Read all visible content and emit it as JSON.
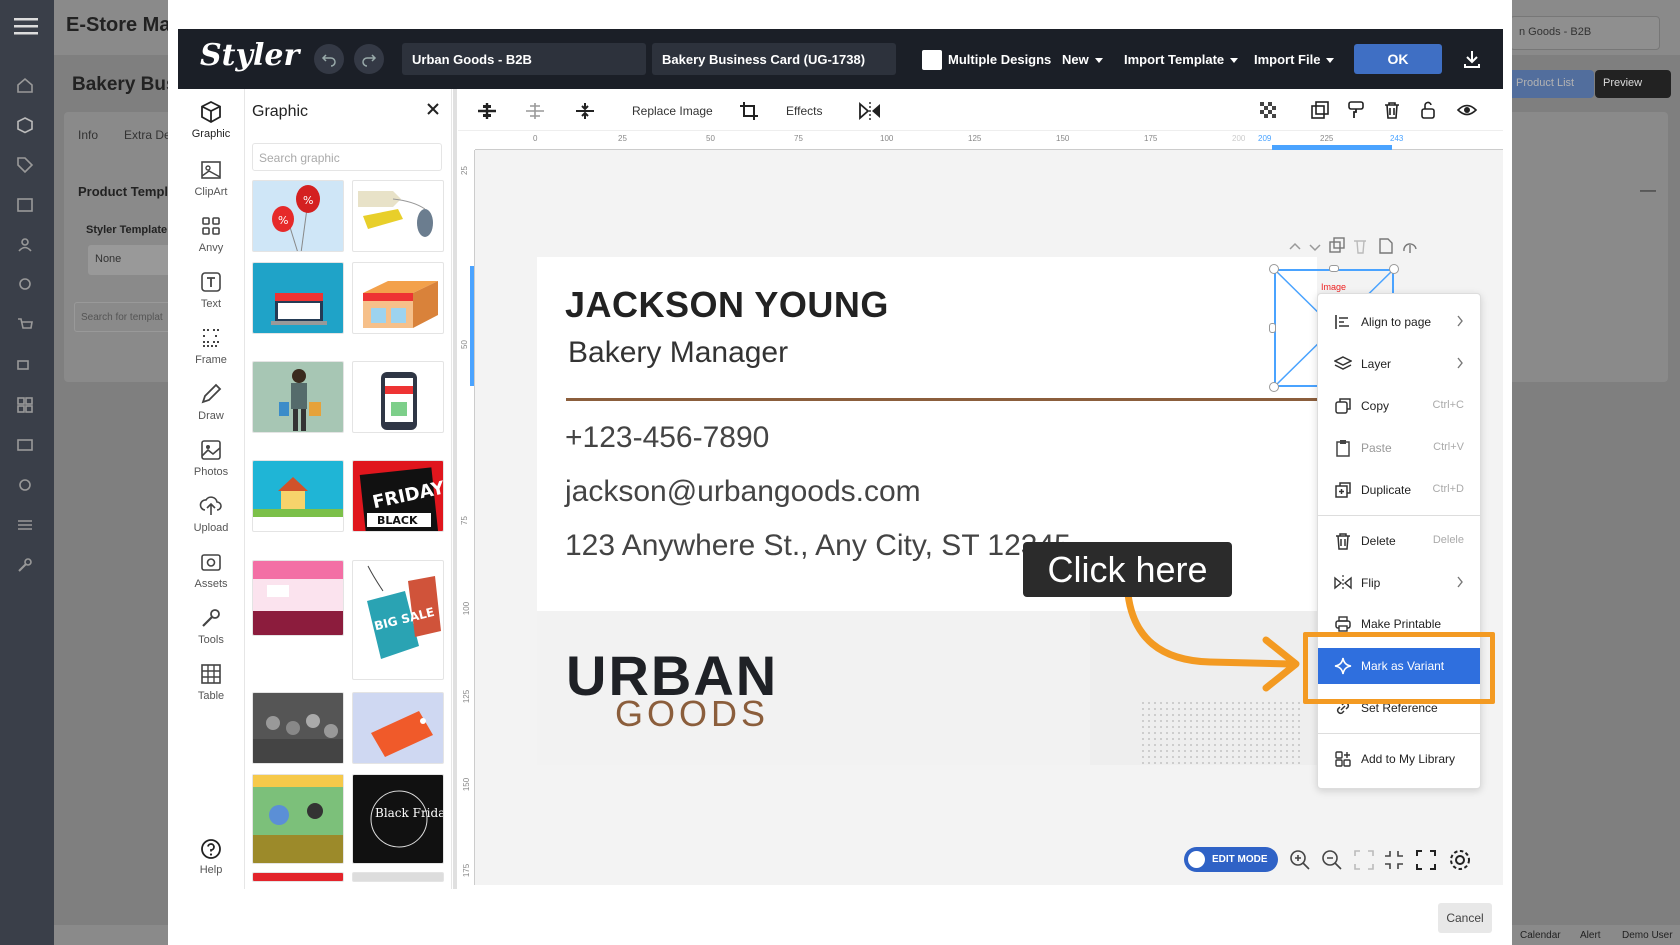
{
  "background_app": {
    "title": "E-Store Mar",
    "page_title": "Bakery Bus",
    "store_select": "n Goods - B2B",
    "product_list_button": "Product List",
    "preview_button": "Preview",
    "tabs": [
      "Info",
      "Extra De"
    ],
    "section_title": "Product Templa",
    "styler_template_label": "Styler Template",
    "styler_template_value": "None",
    "search_placeholder": "Search for templat",
    "footer": [
      "Calendar",
      "Alert",
      "Demo User"
    ]
  },
  "styler": {
    "logo": "Styler",
    "store_name": "Urban Goods - B2B",
    "design_name": "Bakery Business Card (UG-1738)",
    "multiple_designs_label": "Multiple Designs",
    "menus": [
      "New",
      "Import Template",
      "Import File"
    ],
    "ok_label": "OK",
    "cancel_label": "Cancel"
  },
  "tool_rail": [
    {
      "label": "Graphic",
      "icon": "cube-icon",
      "active": true
    },
    {
      "label": "ClipArt",
      "icon": "clipart-icon"
    },
    {
      "label": "Anvy",
      "icon": "grid-icon"
    },
    {
      "label": "Text",
      "icon": "text-icon"
    },
    {
      "label": "Frame",
      "icon": "frame-icon"
    },
    {
      "label": "Draw",
      "icon": "pen-icon"
    },
    {
      "label": "Photos",
      "icon": "image-icon"
    },
    {
      "label": "Upload",
      "icon": "upload-icon"
    },
    {
      "label": "Assets",
      "icon": "camera-icon"
    },
    {
      "label": "Tools",
      "icon": "wrench-icon"
    },
    {
      "label": "Table",
      "icon": "table-icon"
    },
    {
      "label": "Help",
      "icon": "help-icon"
    }
  ],
  "graphic_panel": {
    "title": "Graphic",
    "search_placeholder": "Search graphic",
    "thumb_texts": {
      "black_friday": "FRIDAY",
      "black_friday_sub": "BLACK",
      "big_sale": "BIG SALE",
      "black_friday_round": "Black Friday"
    }
  },
  "toolbar": {
    "replace_image": "Replace Image",
    "effects": "Effects"
  },
  "ruler": {
    "top_ticks": [
      "0",
      "25",
      "50",
      "75",
      "100",
      "125",
      "150",
      "175",
      "200",
      "209",
      "225",
      "243"
    ],
    "left_ticks": [
      "25",
      "50",
      "75",
      "100",
      "125",
      "150",
      "175"
    ]
  },
  "card": {
    "name": "JACKSON YOUNG",
    "title": "Bakery Manager",
    "phone": "+123-456-7890",
    "email": "jackson@urbangoods.com",
    "address": "123 Anywhere St., Any City, ST 12345",
    "logo_line1": "URBAN",
    "logo_line2": "GOODS"
  },
  "selection": {
    "label": "Image"
  },
  "context_menu": [
    {
      "label": "Align to page",
      "icon": "align-icon",
      "submenu": true
    },
    {
      "label": "Layer",
      "icon": "layers-icon",
      "submenu": true
    },
    {
      "label": "Copy",
      "icon": "copy-icon",
      "shortcut": "Ctrl+C"
    },
    {
      "label": "Paste",
      "icon": "paste-icon",
      "shortcut": "Ctrl+V"
    },
    {
      "label": "Duplicate",
      "icon": "duplicate-icon",
      "shortcut": "Ctrl+D"
    },
    {
      "label": "Delete",
      "icon": "trash-icon",
      "shortcut": "Delele"
    },
    {
      "label": "Flip",
      "icon": "flip-icon",
      "submenu": true
    },
    {
      "label": "Make Printable",
      "icon": "print-icon"
    },
    {
      "label": "Mark as Variant",
      "icon": "sparkle-icon",
      "highlighted": true
    },
    {
      "label": "Set Reference",
      "icon": "link-icon"
    },
    {
      "label": "Add to My Library",
      "icon": "library-icon"
    }
  ],
  "annotation": {
    "callout": "Click here",
    "color": "#f39a22"
  },
  "bottom": {
    "edit_mode": "EDIT MODE"
  },
  "colors": {
    "accent": "#2f6fde",
    "topbar": "#1b1f27",
    "brown": "#8b5e3c"
  }
}
